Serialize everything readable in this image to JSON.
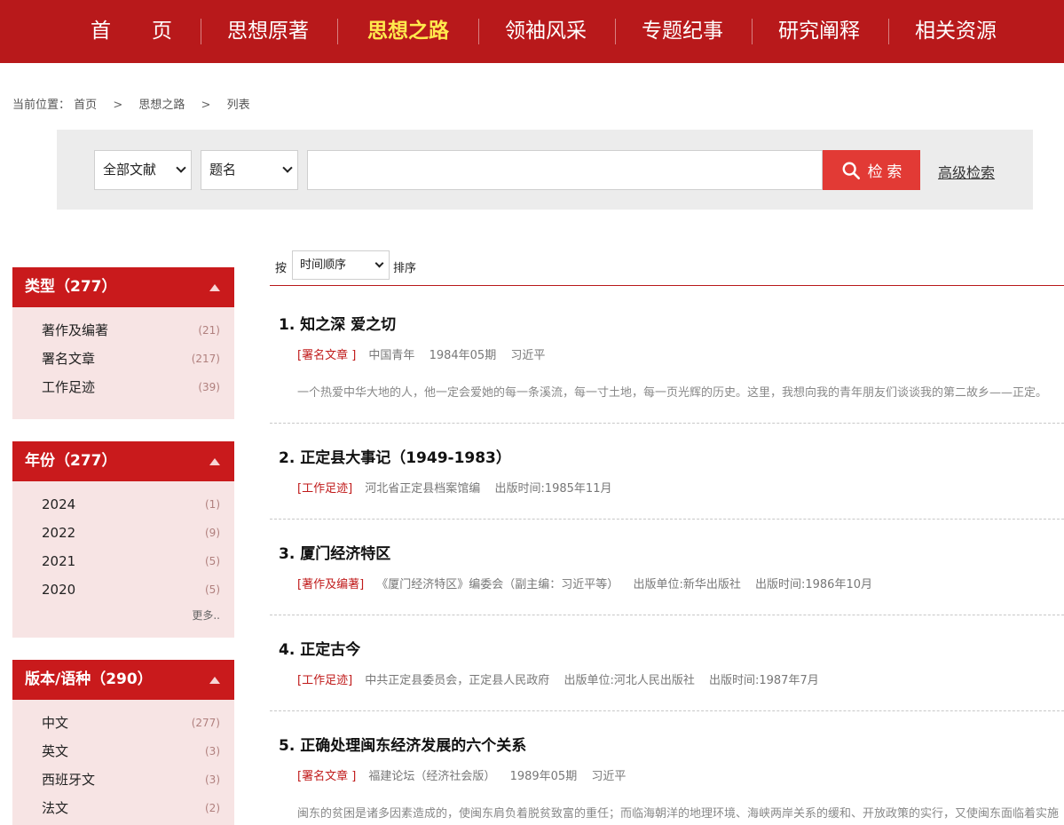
{
  "nav": {
    "items": [
      {
        "label": "首　　页"
      },
      {
        "label": "思想原著"
      },
      {
        "label": "思想之路"
      },
      {
        "label": "领袖风采"
      },
      {
        "label": "专题纪事"
      },
      {
        "label": "研究阐释"
      },
      {
        "label": "相关资源"
      }
    ],
    "active_index": 2
  },
  "breadcrumb": {
    "prefix": "当前位置：",
    "items": [
      "首页",
      "思想之路",
      "列表"
    ],
    "separator": ">"
  },
  "search": {
    "scope_select": "全部文献",
    "field_select": "题名",
    "query_value": "",
    "query_placeholder": "",
    "button_label": "检 索",
    "advanced_label": "高级检索"
  },
  "facets": [
    {
      "title": "类型（277）",
      "items": [
        {
          "label": "著作及编著",
          "count": "(21)"
        },
        {
          "label": "署名文章",
          "count": "(217)"
        },
        {
          "label": "工作足迹",
          "count": "(39)"
        }
      ],
      "more": ""
    },
    {
      "title": "年份（277）",
      "items": [
        {
          "label": "2024",
          "count": "(1)"
        },
        {
          "label": "2022",
          "count": "(9)"
        },
        {
          "label": "2021",
          "count": "(5)"
        },
        {
          "label": "2020",
          "count": "(5)"
        }
      ],
      "more": "更多.."
    },
    {
      "title": "版本/语种（290）",
      "items": [
        {
          "label": "中文",
          "count": "(277)"
        },
        {
          "label": "英文",
          "count": "(3)"
        },
        {
          "label": "西班牙文",
          "count": "(3)"
        },
        {
          "label": "法文",
          "count": "(2)"
        }
      ],
      "more": ""
    }
  ],
  "sort": {
    "prefix": "按",
    "selected": "时间顺序",
    "suffix": "排序"
  },
  "results": [
    {
      "title": "1.  知之深 爱之切",
      "tag": "[署名文章 ]",
      "meta": [
        "中国青年",
        "1984年05期",
        "习近平"
      ],
      "abstract": "一个热爱中华大地的人，他一定会爱她的每一条溪流，每一寸土地，每一页光辉的历史。这里，我想向我的青年朋友们谈谈我的第二故乡——正定。"
    },
    {
      "title": "2.  正定县大事记（1949-1983）",
      "tag": "[工作足迹]",
      "meta": [
        "河北省正定县档案馆编",
        "出版时间:1985年11月"
      ],
      "abstract": ""
    },
    {
      "title": "3.  厦门经济特区",
      "tag": "[著作及编著]",
      "meta": [
        "《厦门经济特区》编委会（副主编：习近平等）",
        "出版单位:新华出版社",
        "出版时间:1986年10月"
      ],
      "abstract": ""
    },
    {
      "title": "4.  正定古今",
      "tag": "[工作足迹]",
      "meta": [
        "中共正定县委员会，正定县人民政府",
        "出版单位:河北人民出版社",
        "出版时间:1987年7月"
      ],
      "abstract": ""
    },
    {
      "title": "5.  正确处理闽东经济发展的六个关系",
      "tag": "[署名文章 ]",
      "meta": [
        "福建论坛（经济社会版）",
        "1989年05期",
        "习近平"
      ],
      "abstract": "闽东的贫困是诸多因素造成的，使闽东肩负着脱贫致富的重任；而临海朝洋的地理环境、海峡两岸关系的缓和、开放政策的实行，又使闽东面临着实施"
    }
  ],
  "colors": {
    "nav_bg": "#b8191b",
    "nav_active": "#ffe94d",
    "facet_head": "#c91a1c",
    "facet_body": "#f7e4e4",
    "search_btn": "#e23a35",
    "tag_red": "#c01a1a"
  }
}
